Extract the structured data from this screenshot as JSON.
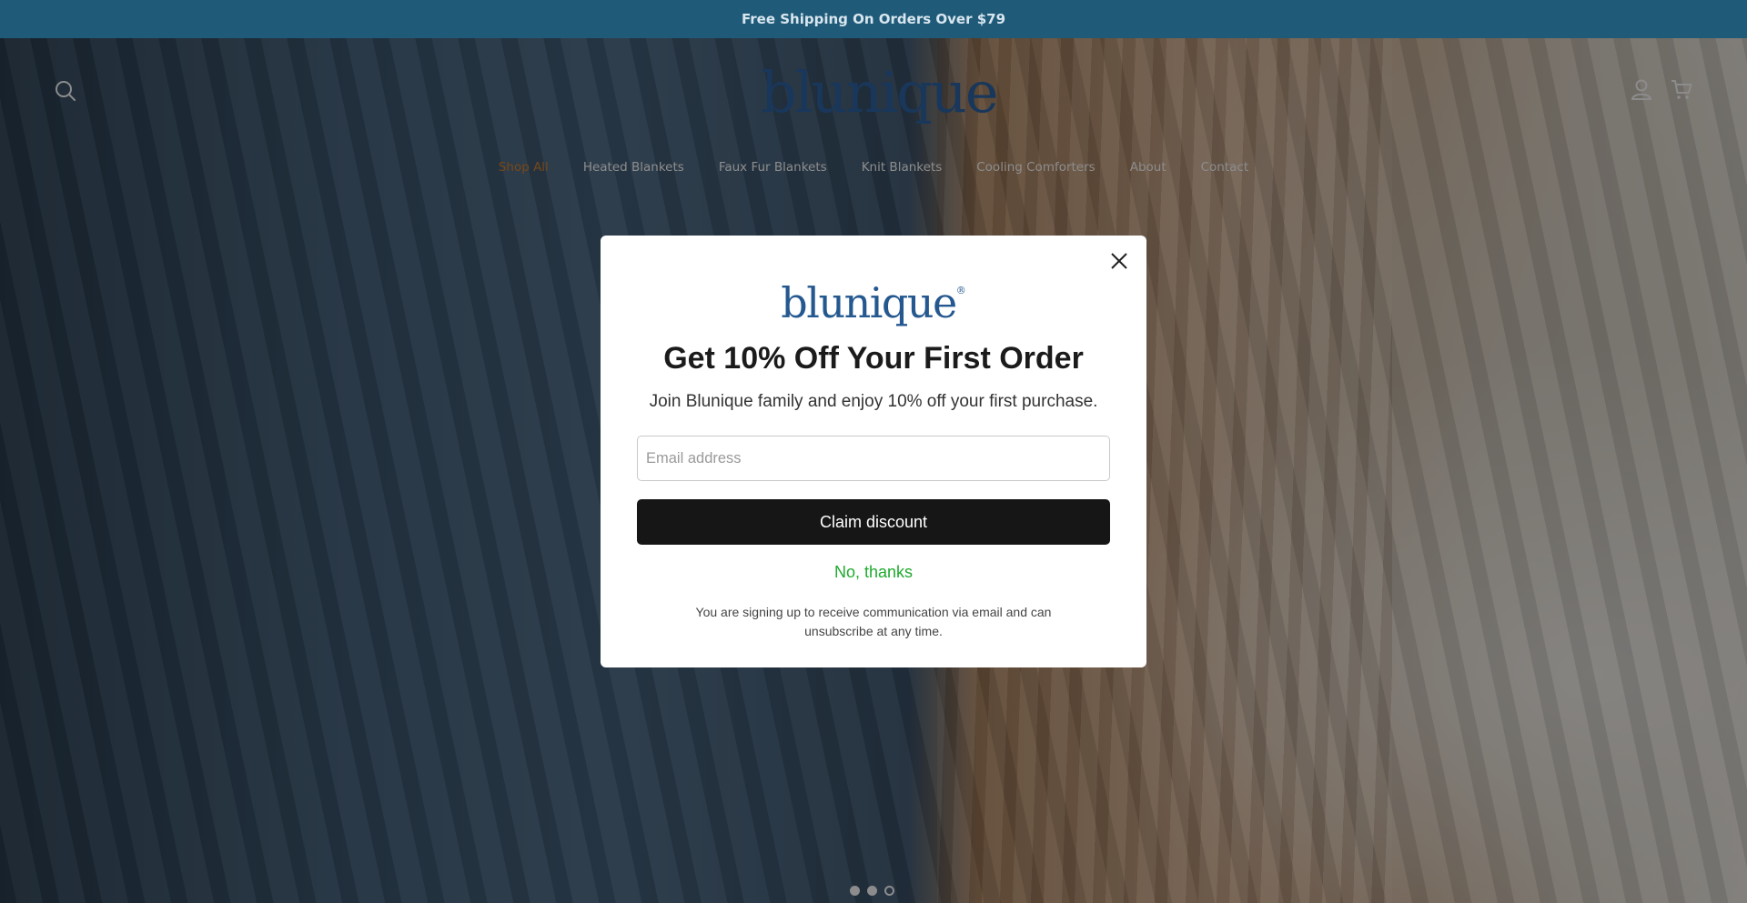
{
  "announcement": {
    "text": "Free Shipping On Orders Over $79"
  },
  "header": {
    "logo_text": "blunique",
    "icons": {
      "search": "search-icon",
      "account": "account-icon",
      "cart": "cart-icon"
    }
  },
  "nav": {
    "items": [
      {
        "label": "Shop All",
        "active": true
      },
      {
        "label": "Heated Blankets"
      },
      {
        "label": "Faux Fur Blankets"
      },
      {
        "label": "Knit Blankets"
      },
      {
        "label": "Cooling Comforters"
      },
      {
        "label": "About"
      },
      {
        "label": "Contact"
      }
    ]
  },
  "popup": {
    "logo_text": "blunique",
    "logo_mark": "®",
    "title": "Get 10% Off Your First Order",
    "subtitle": "Join Blunique family and enjoy 10% off your first purchase.",
    "email_placeholder": "Email address",
    "email_value": "",
    "claim_label": "Claim discount",
    "decline_label": "No, thanks",
    "disclaimer": "You are signing up to receive communication via email and can unsubscribe at any time."
  },
  "carousel": {
    "slide_count": 3,
    "current_slide": 3
  },
  "colors": {
    "announcement_bg": "#1f5a78",
    "logo_blue": "#24588f",
    "nav_active": "#d9822b",
    "decline_green": "#1faa2e",
    "button_black": "#161616"
  }
}
